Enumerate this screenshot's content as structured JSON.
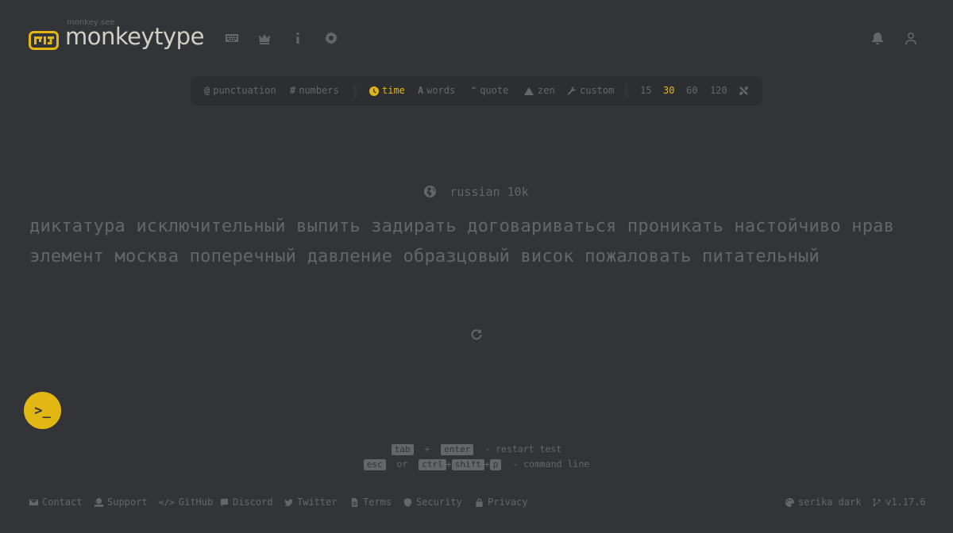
{
  "header": {
    "logo_top": "monkey see",
    "logo_main": "monkeytype",
    "nav_icons": [
      "keyboard-icon",
      "crown-icon",
      "info-icon",
      "gear-icon"
    ],
    "right_icons": [
      "bell-icon",
      "user-icon"
    ]
  },
  "config": {
    "punctuation": "punctuation",
    "numbers": "numbers",
    "time": "time",
    "words": "words",
    "quote": "quote",
    "zen": "zen",
    "custom": "custom",
    "durations": [
      "15",
      "30",
      "60",
      "120"
    ],
    "active_mode": "time",
    "active_duration": "30"
  },
  "test": {
    "language": "russian 10k",
    "line1": "диктатура исключительный выпить задирать договариваться проникать настойчиво нрав",
    "line2": "элемент москва поперечный давление образцовый висок пожаловать питательный"
  },
  "command_button": ">_",
  "hints": {
    "line1": {
      "k1": "tab",
      "plus": "+",
      "k2": "enter",
      "text": "- restart test"
    },
    "line2": {
      "k1": "esc",
      "or": "or",
      "k2": "ctrl",
      "plus1": "+",
      "k3": "shift",
      "plus2": "+",
      "k4": "p",
      "text": "- command line"
    }
  },
  "footer": {
    "links": [
      "Contact",
      "Support",
      "GitHub",
      "Discord",
      "Twitter",
      "Terms",
      "Security",
      "Privacy"
    ],
    "theme": "serika dark",
    "version": "v1.17.6"
  },
  "colors": {
    "background": "#323437",
    "sub_background": "#2c2e31",
    "accent": "#e2b714",
    "text": "#d1d0c5",
    "sub": "#646669"
  }
}
